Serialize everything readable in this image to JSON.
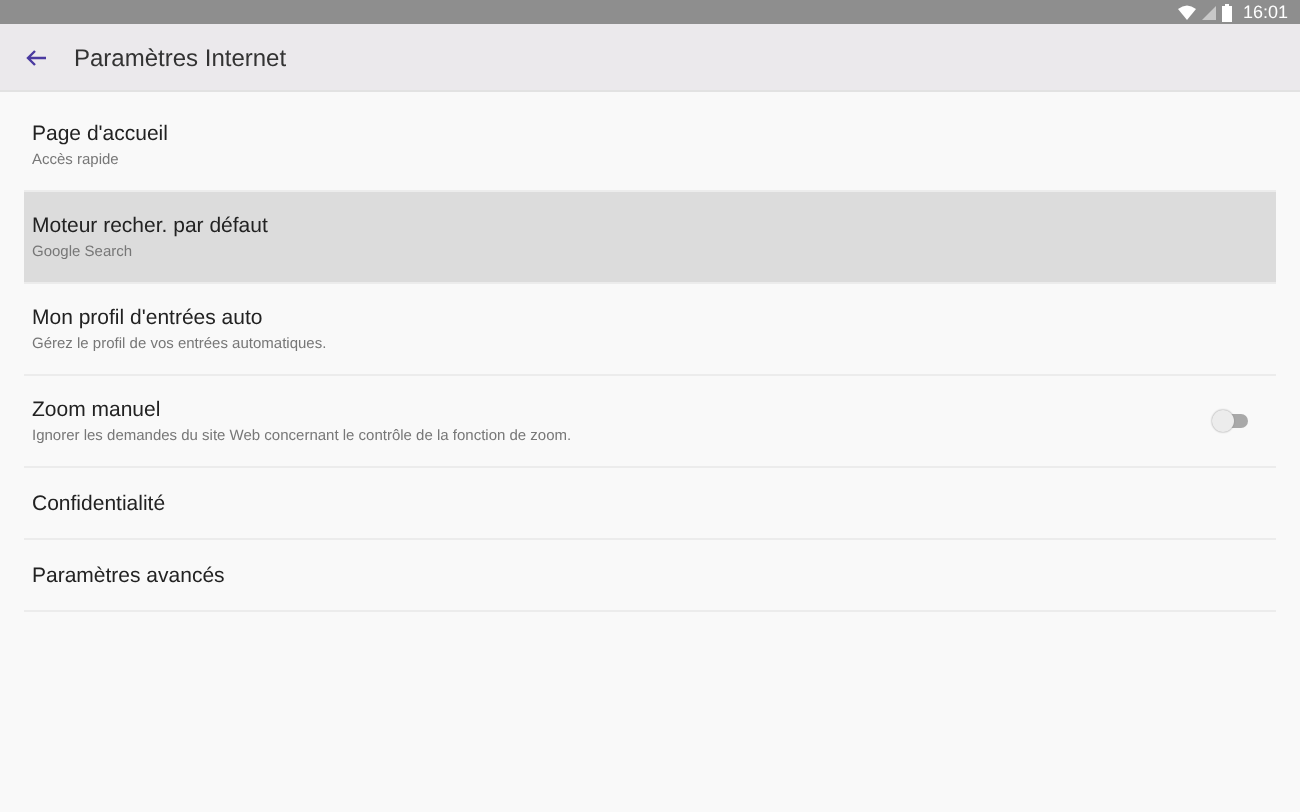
{
  "status_bar": {
    "time": "16:01"
  },
  "header": {
    "title": "Paramètres Internet"
  },
  "settings": [
    {
      "kind": "item",
      "title": "Page d'accueil",
      "subtitle": "Accès rapide",
      "selected": false
    },
    {
      "kind": "item",
      "title": "Moteur recher. par défaut",
      "subtitle": "Google Search",
      "selected": true
    },
    {
      "kind": "item",
      "title": "Mon profil d'entrées auto",
      "subtitle": "Gérez le profil de vos entrées automatiques.",
      "selected": false
    },
    {
      "kind": "switch",
      "title": "Zoom manuel",
      "subtitle": "Ignorer les demandes du site Web concernant le contrôle de la fonction de zoom.",
      "selected": false,
      "on": false
    },
    {
      "kind": "item",
      "title": "Confidentialité",
      "selected": false
    },
    {
      "kind": "item",
      "title": "Paramètres avancés",
      "selected": false
    }
  ]
}
